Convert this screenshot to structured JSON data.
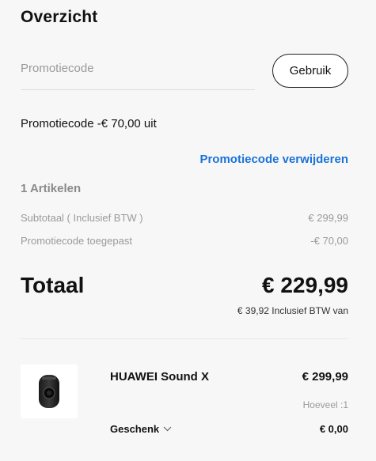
{
  "summary": {
    "title": "Overzicht",
    "promo": {
      "placeholder": "Promotiecode",
      "apply_label": "Gebruik",
      "applied_text": "Promotiecode -€ 70,00 uit",
      "remove_label": "Promotiecode verwijderen"
    },
    "item_count": "1 Artikelen",
    "rows": [
      {
        "label": "Subtotaal ( Inclusief BTW )",
        "value": "€ 299,99"
      },
      {
        "label": "Promotiecode toegepast",
        "value": "-€ 70,00"
      }
    ],
    "total_label": "Totaal",
    "total_value": "€ 229,99",
    "vat_note": "€ 39,92 Inclusief BTW van"
  },
  "product": {
    "name": "HUAWEI Sound X",
    "price": "€ 299,99",
    "quantity": "Hoeveel :1",
    "gift_label": "Geschenk",
    "gift_price": "€ 0,00",
    "image_icon": "speaker-product-image"
  },
  "colors": {
    "background": "#f7f7f7",
    "link": "#1a73d9",
    "muted": "#9a9a9a"
  }
}
